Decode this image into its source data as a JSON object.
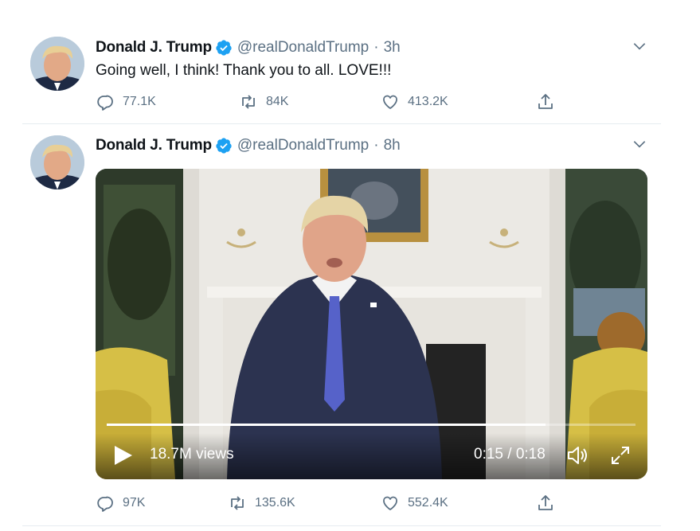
{
  "tweets": [
    {
      "name": "Donald J. Trump",
      "handle": "@realDonaldTrump",
      "separator": "·",
      "time": "3h",
      "text": "Going well, I think! Thank you to all. LOVE!!!",
      "reply_count": "77.1K",
      "retweet_count": "84K",
      "like_count": "413.2K"
    },
    {
      "name": "Donald J. Trump",
      "handle": "@realDonaldTrump",
      "separator": "·",
      "time": "8h",
      "video": {
        "views": "18.7M views",
        "time": "0:15 / 0:18",
        "progress": 0.83
      },
      "reply_count": "97K",
      "retweet_count": "135.6K",
      "like_count": "552.4K"
    }
  ],
  "colors": {
    "verified": "#1da1f2",
    "muted": "#5b7083",
    "divider": "#e6ecf0"
  },
  "icons": [
    "verified-badge-icon",
    "chevron-down-icon",
    "reply-icon",
    "retweet-icon",
    "like-icon",
    "share-icon",
    "play-icon",
    "volume-icon",
    "fullscreen-icon"
  ]
}
